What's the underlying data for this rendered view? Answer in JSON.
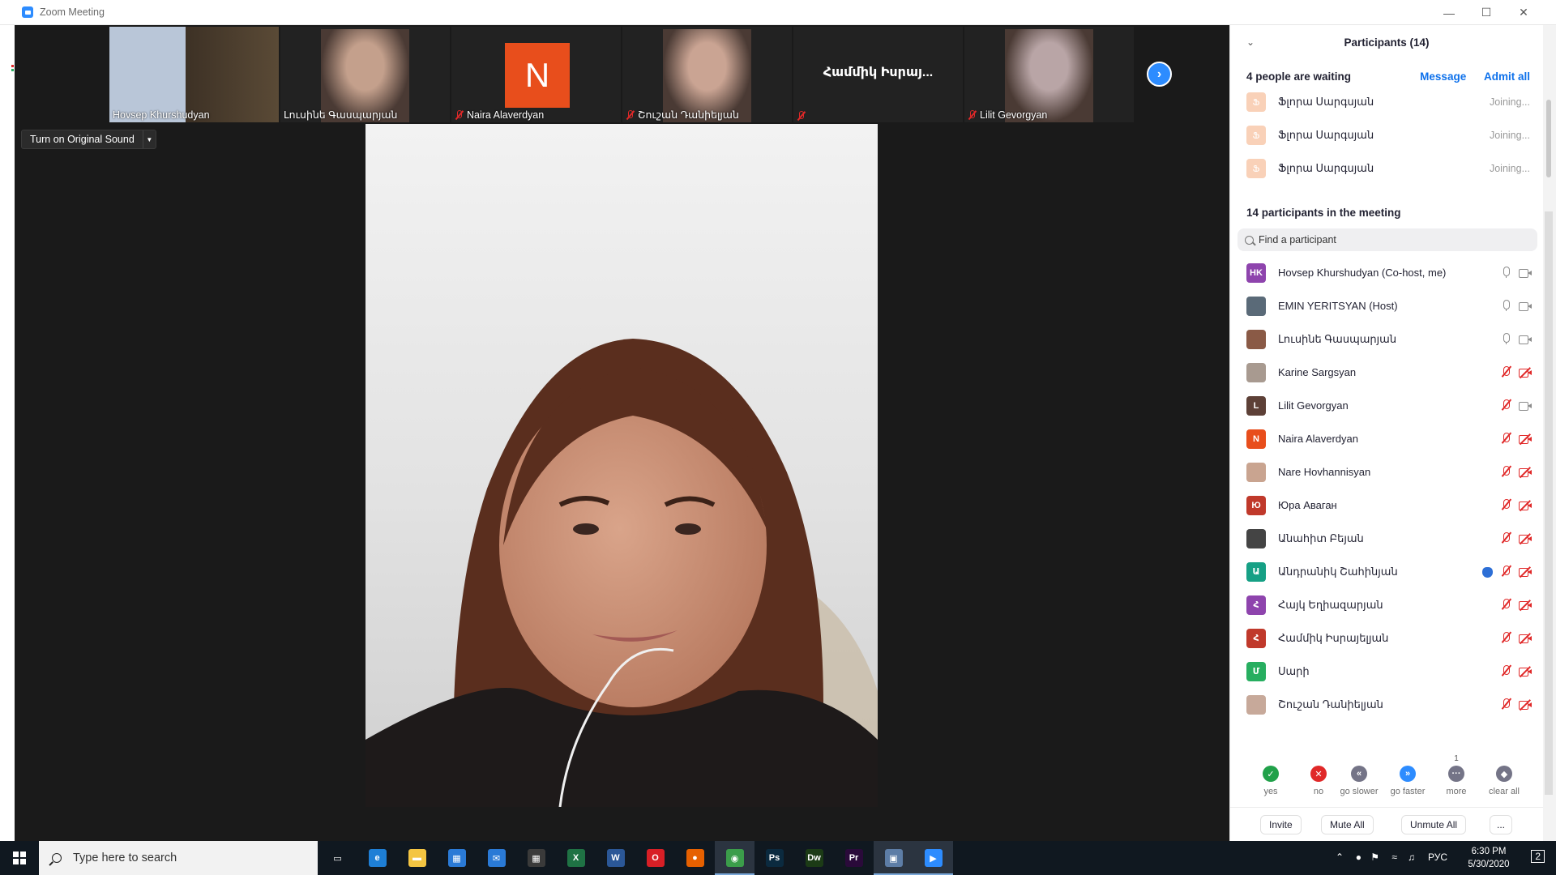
{
  "window": {
    "title": "Zoom Meeting"
  },
  "thumbnails": [
    {
      "name": "Hovsep Khurshudyan",
      "muted": false,
      "kind": "video"
    },
    {
      "name": "Լուսինե Գասպարյան",
      "muted": false,
      "kind": "video"
    },
    {
      "name": "Naira Alaverdyan",
      "muted": true,
      "kind": "avatar",
      "initial": "N"
    },
    {
      "name": "Շուշան Դանիելյան",
      "muted": true,
      "kind": "video"
    },
    {
      "name": "",
      "muted": true,
      "kind": "name",
      "display": "Համմիկ Իսրայ..."
    },
    {
      "name": "Lilit Gevorgyan",
      "muted": true,
      "kind": "video"
    }
  ],
  "original_sound_label": "Turn on Original Sound",
  "panel": {
    "title": "Participants (14)",
    "waiting_header": "4 people are waiting",
    "message_label": "Message",
    "admit_all_label": "Admit all",
    "waiting": [
      {
        "initial": "Ֆ",
        "name": "Ֆլորա Սարգսյան",
        "status": "Joining..."
      },
      {
        "initial": "Ֆ",
        "name": "Ֆլորա Սարգսյան",
        "status": "Joining..."
      },
      {
        "initial": "Ֆ",
        "name": "Ֆլորա Սարգսյան",
        "status": "Joining..."
      }
    ],
    "in_meeting_header": "14 participants in the meeting",
    "search_placeholder": "Find a participant",
    "participants": [
      {
        "name": "Hovsep Khurshudyan (Co-host, me)",
        "initials": "HK",
        "color": "#8e44ad",
        "mic": "on",
        "cam": "on",
        "hand": false
      },
      {
        "name": "EMIN YERITSYAN (Host)",
        "initials": "",
        "color": "#5a6a78",
        "mic": "on",
        "cam": "on",
        "hand": false
      },
      {
        "name": "Լուսինե Գասպարյան",
        "initials": "",
        "color": "#8a5a46",
        "mic": "on",
        "cam": "on",
        "hand": false
      },
      {
        "name": "Karine Sargsyan",
        "initials": "",
        "color": "#a89a90",
        "mic": "off",
        "cam": "off",
        "hand": false
      },
      {
        "name": "Lilit Gevorgyan",
        "initials": "L",
        "color": "#5d4037",
        "mic": "off",
        "cam": "on",
        "hand": false
      },
      {
        "name": "Naira Alaverdyan",
        "initials": "N",
        "color": "#e84e1c",
        "mic": "off",
        "cam": "off",
        "hand": false
      },
      {
        "name": "Nare Hovhannisyan",
        "initials": "",
        "color": "#c9a490",
        "mic": "off",
        "cam": "off",
        "hand": false
      },
      {
        "name": "Юра Аваган",
        "initials": "Ю",
        "color": "#c0392b",
        "mic": "off",
        "cam": "off",
        "hand": false
      },
      {
        "name": "Անահիտ Բեյան",
        "initials": "",
        "color": "#444444",
        "mic": "off",
        "cam": "off",
        "hand": false
      },
      {
        "name": "Անդրանիկ Շահինյան",
        "initials": "Ա",
        "color": "#16a085",
        "mic": "off",
        "cam": "off",
        "hand": true
      },
      {
        "name": "Հայկ Եղիազարյան",
        "initials": "Հ",
        "color": "#8e44ad",
        "mic": "off",
        "cam": "off",
        "hand": false
      },
      {
        "name": "Համմիկ Իսրայելյան",
        "initials": "Հ",
        "color": "#c0392b",
        "mic": "off",
        "cam": "off",
        "hand": false
      },
      {
        "name": "Սարի",
        "initials": "Մ",
        "color": "#27ae60",
        "mic": "off",
        "cam": "off",
        "hand": false
      },
      {
        "name": "Շուշան Դանիելյան",
        "initials": "",
        "color": "#c7a99a",
        "mic": "off",
        "cam": "off",
        "hand": false
      }
    ],
    "feedback": [
      {
        "label": "yes",
        "count": "",
        "color": "#21a14a",
        "glyph": "✓"
      },
      {
        "label": "no",
        "count": "",
        "color": "#e02828",
        "glyph": "✕"
      },
      {
        "label": "go slower",
        "count": "",
        "color": "#747487",
        "glyph": "«"
      },
      {
        "label": "go faster",
        "count": "",
        "color": "#2d8cff",
        "glyph": "»"
      },
      {
        "label": "more",
        "count": "1",
        "color": "#747487",
        "glyph": "···"
      },
      {
        "label": "clear all",
        "count": "",
        "color": "#747487",
        "glyph": "◆"
      }
    ],
    "invite_label": "Invite",
    "mute_all_label": "Mute All",
    "unmute_all_label": "Unmute All",
    "more_label": "..."
  },
  "taskbar": {
    "search_placeholder": "Type here to search",
    "apps": [
      {
        "icon": "task-view-icon",
        "color": "#101820",
        "glyph": "▭"
      },
      {
        "icon": "edge-icon",
        "color": "#1e7fd6",
        "glyph": "e"
      },
      {
        "icon": "file-explorer-icon",
        "color": "#f4c542",
        "glyph": "▬"
      },
      {
        "icon": "store-icon",
        "color": "#2a7ad6",
        "glyph": "▦"
      },
      {
        "icon": "mail-icon",
        "color": "#2a7ad6",
        "glyph": "✉"
      },
      {
        "icon": "calculator-icon",
        "color": "#3a3a3a",
        "glyph": "▦"
      },
      {
        "icon": "excel-icon",
        "color": "#1f7244",
        "glyph": "X"
      },
      {
        "icon": "word-icon",
        "color": "#2b5797",
        "glyph": "W"
      },
      {
        "icon": "opera-icon",
        "color": "#d81f26",
        "glyph": "O"
      },
      {
        "icon": "firefox-icon",
        "color": "#e66000",
        "glyph": "●"
      },
      {
        "icon": "chrome-icon",
        "color": "#3b9d4a",
        "glyph": "◉"
      },
      {
        "icon": "photoshop-icon",
        "color": "#0b2a3f",
        "glyph": "Ps"
      },
      {
        "icon": "dreamweaver-icon",
        "color": "#1c3b16",
        "glyph": "Dw"
      },
      {
        "icon": "premiere-icon",
        "color": "#2a0a3a",
        "glyph": "Pr"
      },
      {
        "icon": "network-app-icon",
        "color": "#5d7da6",
        "glyph": "▣"
      },
      {
        "icon": "zoom-icon",
        "color": "#2d8cff",
        "glyph": "▶"
      }
    ],
    "language": "РУС",
    "time": "6:30 PM",
    "date": "5/30/2020",
    "notifications": "2"
  }
}
